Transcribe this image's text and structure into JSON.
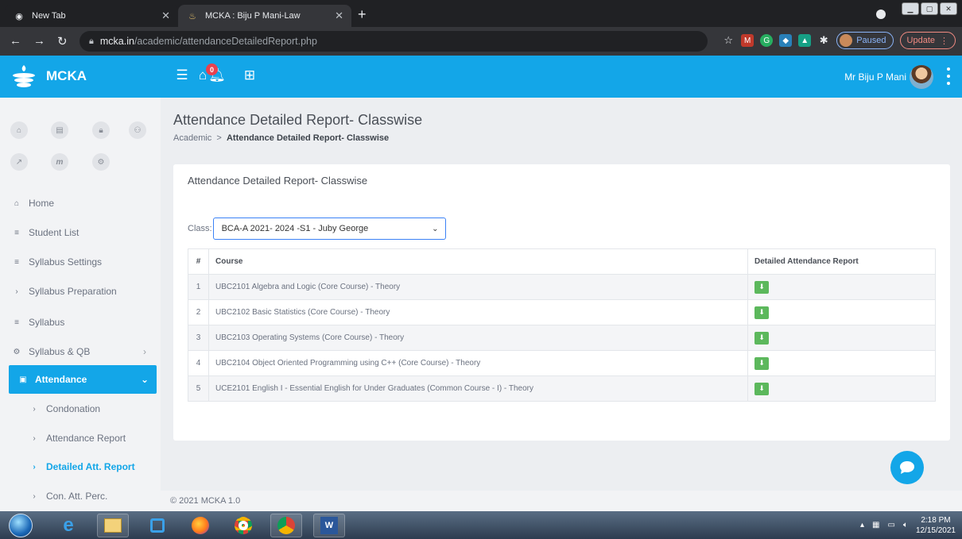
{
  "browser": {
    "tabs": [
      {
        "label": "New Tab",
        "active": false
      },
      {
        "label": "MCKA : Biju P Mani-Law",
        "active": true
      }
    ],
    "url_host": "mcka.in",
    "url_path": "/academic/attendanceDetailedReport.php",
    "profile_status": "Paused",
    "update_label": "Update"
  },
  "header": {
    "brand": "MCKA",
    "notification_count": "0",
    "user_name": "Mr Biju P Mani"
  },
  "sidebar": {
    "items": [
      {
        "label": "Home",
        "icon": "home-icon"
      },
      {
        "label": "Student List",
        "icon": "list-icon"
      },
      {
        "label": "Syllabus Settings",
        "icon": "list-icon"
      },
      {
        "label": "Syllabus Preparation",
        "icon": "chevron-right-icon"
      },
      {
        "label": "Syllabus",
        "icon": "list-icon"
      },
      {
        "label": "Syllabus & QB",
        "icon": "cogs-icon"
      },
      {
        "label": "Attendance",
        "icon": "calendar-icon"
      }
    ],
    "subitems": [
      {
        "label": "Condonation"
      },
      {
        "label": "Attendance Report"
      },
      {
        "label": "Detailed Att. Report"
      },
      {
        "label": "Con. Att. Perc."
      }
    ]
  },
  "page": {
    "title": "Attendance Detailed Report- Classwise",
    "breadcrumb_root": "Academic",
    "breadcrumb_separator": ">",
    "breadcrumb_current": "Attendance Detailed Report- Classwise",
    "card_title": "Attendance Detailed Report- Classwise",
    "class_label": "Class:",
    "class_value": "BCA-A 2021- 2024 -S1 - Juby George"
  },
  "table": {
    "headers": [
      "#",
      "Course",
      "Detailed Attendance Report"
    ],
    "rows": [
      {
        "num": "1",
        "course": "UBC2101 Algebra and Logic (Core Course) - Theory"
      },
      {
        "num": "2",
        "course": "UBC2102 Basic Statistics (Core Course) - Theory"
      },
      {
        "num": "3",
        "course": "UBC2103 Operating Systems (Core Course) - Theory"
      },
      {
        "num": "4",
        "course": "UBC2104 Object Oriented Programming using C++ (Core Course) - Theory"
      },
      {
        "num": "5",
        "course": "UCE2101 English I - Essential English for Under Graduates (Common Course - I) - Theory"
      }
    ]
  },
  "footer": {
    "text": "© 2021 MCKA 1.0"
  },
  "taskbar": {
    "time": "2:18 PM",
    "date": "12/15/2021"
  },
  "colors": {
    "accent": "#13a6e8",
    "download": "#5cb85c",
    "badge": "#e9414e"
  }
}
